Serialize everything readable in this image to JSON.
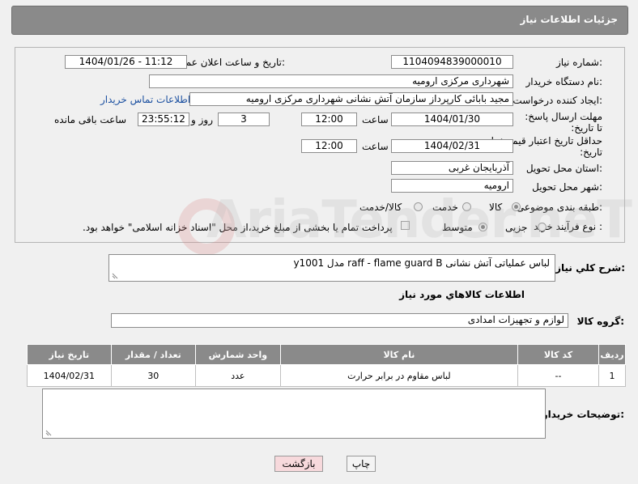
{
  "header": {
    "title": "جزئیات اطلاعات نیاز"
  },
  "fields": {
    "need_number_label": "شماره نیاز:",
    "need_number": "1104094839000010",
    "announce_label": "تاریخ و ساعت اعلان عمومی:",
    "announce_value": "1404/01/26 - 11:12",
    "buyer_org_label": "نام دستگاه خریدار:",
    "buyer_org": "شهرداری مرکزی ارومیه",
    "requester_label": "ایجاد کننده درخواست:",
    "requester": "مجید بابائی کارپرداز سازمان آتش نشانی شهرداری مرکزی ارومیه",
    "contact_link": "اطلاعات تماس خریدار",
    "deadline_label": "مهلت ارسال پاسخ: تا تاریخ:",
    "deadline_date": "1404/01/30",
    "time_label": "ساعت",
    "deadline_time": "12:00",
    "days_value": "3",
    "days_label": "روز و",
    "remaining_time": "23:55:12",
    "remaining_label": "ساعت باقی مانده",
    "price_validity_label": "حداقل تاریخ اعتبار قیمت: تا تاریخ:",
    "price_date": "1404/02/31",
    "price_time_label": "ساعت",
    "price_time": "12:00",
    "province_label": "استان محل تحویل:",
    "province": "آذربایجان غربی",
    "city_label": "شهر محل تحویل:",
    "city": "ارومیه",
    "category_label": "طبقه بندی موضوعی:",
    "category_options": [
      "کالا",
      "خدمت",
      "کالا/خدمت"
    ],
    "process_label": "نوع فرآیند خرید :",
    "process_options": [
      "جزیی",
      "متوسط"
    ],
    "payment_note": "پرداخت تمام یا بخشی از مبلغ خرید،از محل \"اسناد خزانه اسلامی\" خواهد بود."
  },
  "summary": {
    "label": "شرح كلي نياز:",
    "value": "لباس عملیاتی آتش نشانی raff - flame guard B مدل y1001"
  },
  "goods_info": {
    "title": "اطلاعات كالاهاي مورد نياز"
  },
  "goods_group": {
    "label": "گروه کالا:",
    "value": "لوازم و تجهیزات امدادی"
  },
  "table": {
    "headers": [
      "ردیف",
      "کد کالا",
      "نام کالا",
      "واحد شمارش",
      "تعداد / مقدار",
      "تاریخ نیاز"
    ],
    "rows": [
      [
        "1",
        "--",
        "لباس مقاوم در برابر حرارت",
        "عدد",
        "30",
        "1404/02/31"
      ]
    ]
  },
  "notes": {
    "label": "توضیحات خریدار:"
  },
  "buttons": {
    "print": "چاپ",
    "back": "بازگشت"
  },
  "watermark": {
    "text": "AriaTender.neT"
  },
  "colors": {
    "header": "#8a8a8a",
    "link": "#1a4fa0",
    "back_button": "#f7d9dc"
  }
}
